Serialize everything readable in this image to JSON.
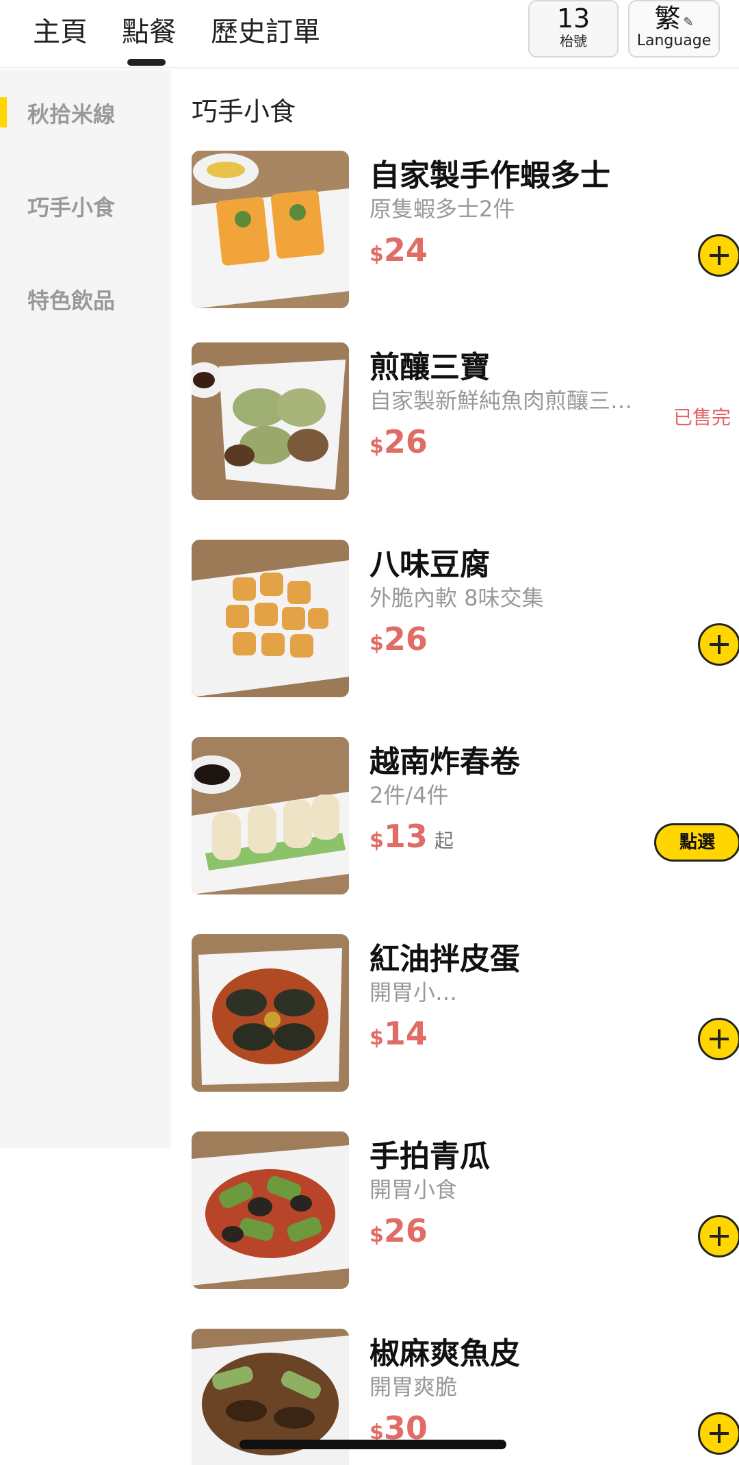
{
  "header": {
    "tabs": [
      {
        "label": "主頁"
      },
      {
        "label": "點餐"
      },
      {
        "label": "歷史訂單"
      }
    ],
    "active_tab": "點餐",
    "table": {
      "number": "13",
      "label": "枱號"
    },
    "language": {
      "current": "繁",
      "label": "Language",
      "icon": "pencil-icon"
    }
  },
  "sidebar": {
    "categories": [
      {
        "label": "秋拾米線",
        "active": true
      },
      {
        "label": "巧手小食",
        "active": false
      },
      {
        "label": "特色飲品",
        "active": false
      }
    ]
  },
  "main": {
    "section_title": "巧手小食",
    "items": [
      {
        "name": "自家製手作蝦多士",
        "desc": "原隻蝦多士2件",
        "currency": "$",
        "price": "24",
        "action": "add"
      },
      {
        "name": "煎釀三寶",
        "desc": "自家製新鮮純魚肉煎釀三…",
        "currency": "$",
        "price": "26",
        "status": "已售完",
        "action": "none"
      },
      {
        "name": "八味豆腐",
        "desc": "外脆內軟 8味交集",
        "currency": "$",
        "price": "26",
        "action": "add"
      },
      {
        "name": "越南炸春卷",
        "desc": "2件/4件",
        "currency": "$",
        "price": "13",
        "price_suffix": "起",
        "action": "select",
        "action_label": "點選"
      },
      {
        "name": "紅油拌皮蛋",
        "desc": "開胃小…",
        "currency": "$",
        "price": "14",
        "action": "add"
      },
      {
        "name": "手拍青瓜",
        "desc": "開胃小食",
        "currency": "$",
        "price": "26",
        "action": "add"
      },
      {
        "name": "椒麻爽魚皮",
        "desc": "開胃爽脆",
        "currency": "$",
        "price": "30",
        "action": "add"
      }
    ]
  },
  "colors": {
    "accent": "#ffd600",
    "price": "#e16c66",
    "soldout": "#e06464",
    "sidebar_bg": "#f5f5f5"
  }
}
